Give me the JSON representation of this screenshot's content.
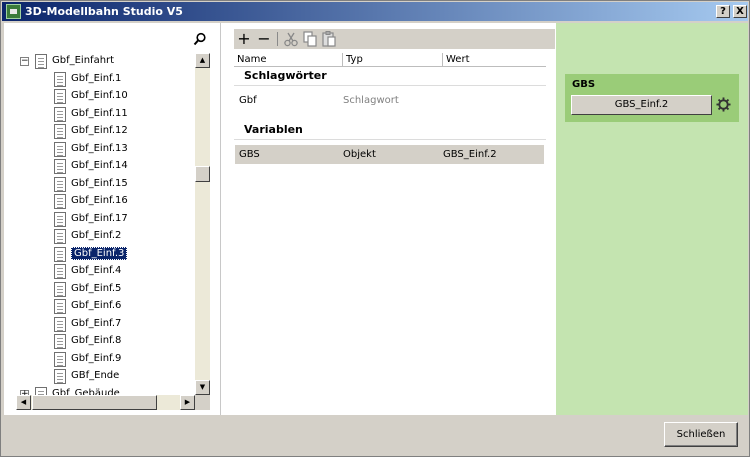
{
  "window": {
    "title": "3D-Modellbahn Studio V5",
    "help": "?",
    "close": "X"
  },
  "tree": {
    "parent": "Gbf_Einfahrt",
    "items": [
      "Gbf_Einf.1",
      "Gbf_Einf.10",
      "Gbf_Einf.11",
      "Gbf_Einf.12",
      "Gbf_Einf.13",
      "Gbf_Einf.14",
      "Gbf_Einf.15",
      "Gbf_Einf.16",
      "Gbf_Einf.17",
      "Gbf_Einf.2",
      "Gbf_Einf.3",
      "Gbf_Einf.4",
      "Gbf_Einf.5",
      "Gbf_Einf.6",
      "Gbf_Einf.7",
      "Gbf_Einf.8",
      "Gbf_Einf.9",
      "GBf_Ende"
    ],
    "selected": "Gbf_Einf.3",
    "next": "Gbf_Gebäude"
  },
  "grid": {
    "headers": {
      "name": "Name",
      "type": "Typ",
      "value": "Wert"
    },
    "sections": {
      "keywords": "Schlagwörter",
      "variables": "Variablen"
    },
    "keyword_row": {
      "name": "Gbf",
      "type": "Schlagwort"
    },
    "variable_row": {
      "name": "GBS",
      "type": "Objekt",
      "value": "GBS_Einf.2"
    }
  },
  "right": {
    "label": "GBS",
    "button": "GBS_Einf.2"
  },
  "footer": {
    "close_label": "Schließen"
  },
  "icons": [
    "search-icon",
    "add-icon",
    "remove-icon",
    "cut-icon",
    "copy-icon",
    "paste-icon",
    "gear-icon",
    "document-icon"
  ]
}
